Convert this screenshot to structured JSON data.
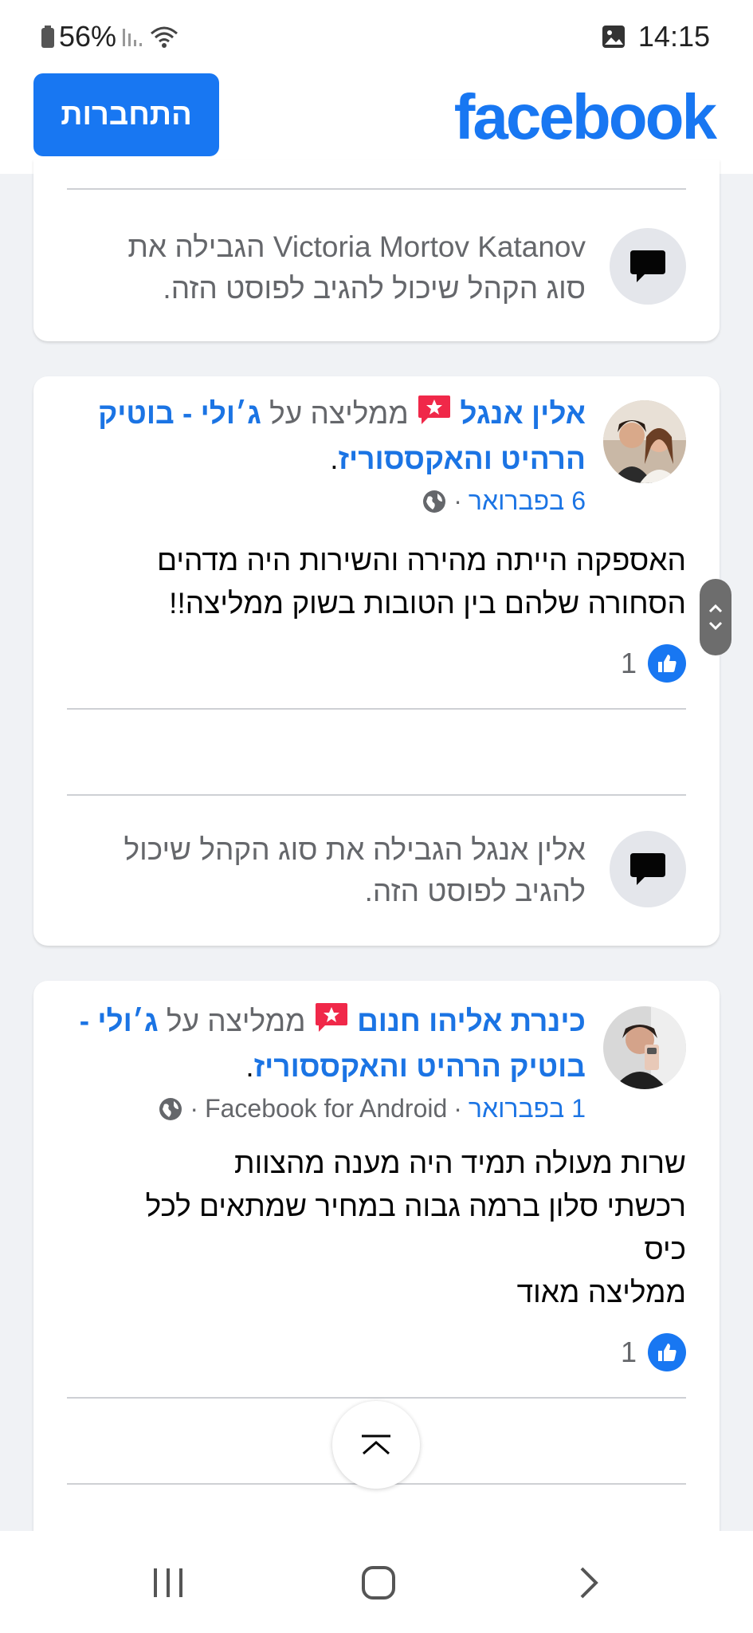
{
  "status_bar": {
    "battery": "56%",
    "time": "14:15"
  },
  "header": {
    "login_label": "התחברות",
    "logo_text": "facebook"
  },
  "restricted_top": {
    "text": "Victoria Mortov Katanov הגבילה את סוג הקהל שיכול להגיב לפוסט הזה."
  },
  "post1": {
    "author": "אלין אנגל",
    "recommends_word": "ממליצה על",
    "page": "ג׳ולי - בוטיק הרהיט והאקססוריז",
    "date": "6 בפברואר",
    "body_lines": [
      "האספקה הייתה מהירה והשירות היה מדהים",
      "הסחורה שלהם בין הטובות בשוק ממליצה!!"
    ],
    "likes": "1",
    "restricted_text": "אלין אנגל הגבילה את סוג הקהל שיכול להגיב לפוסט הזה."
  },
  "post2": {
    "author": "כינרת אליהו חנום",
    "recommends_word": "ממליצה על",
    "page": "ג׳ולי - בוטיק הרהיט והאקססוריז",
    "date": "1 בפברואר",
    "source": "Facebook for Android",
    "body_lines": [
      "שרות מעולה תמיד היה מענה מהצוות",
      "רכשתי סלון ברמה גבוה  במחיר שמתאים לכל",
      "כיס",
      "ממליצה מאוד"
    ],
    "likes": "1"
  },
  "colors": {
    "brand": "#1877f2",
    "link": "#1b74e4",
    "muted": "#65676b",
    "background": "#f0f2f5"
  },
  "icons": [
    "battery-icon",
    "signal-icon",
    "wifi-icon",
    "gallery-icon",
    "comment-bubble-icon",
    "globe-icon",
    "like-icon",
    "scroll-up-icon",
    "scroll-down-icon",
    "scroll-to-top-icon",
    "recents-icon",
    "home-icon",
    "back-icon"
  ]
}
